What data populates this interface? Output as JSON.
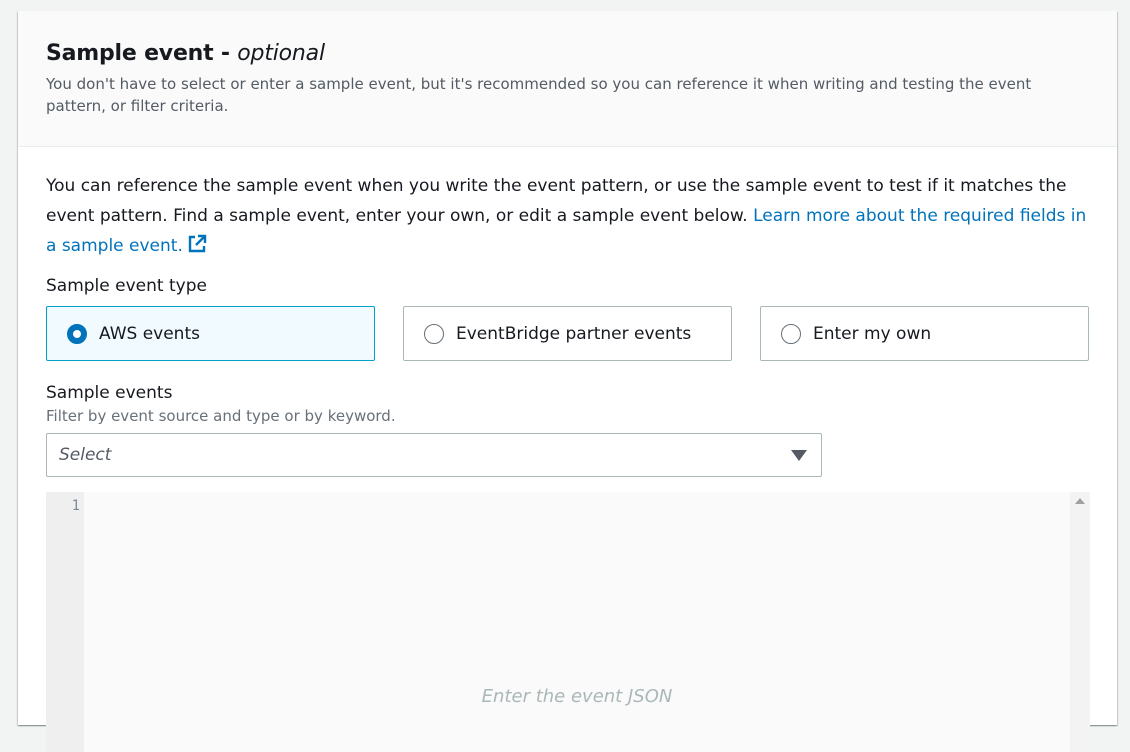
{
  "panel": {
    "title": "Sample event - ",
    "title_optional": "optional",
    "description": "You don't have to select or enter a sample event, but it's recommended so you can reference it when writing and testing the event pattern, or filter criteria."
  },
  "body": {
    "intro_text": "You can reference the sample event when you write the event pattern, or use the sample event to test if it matches the event pattern. Find a sample event, enter your own, or edit a sample event below. ",
    "learn_more_link": "Learn more about the required fields in a sample event.",
    "external_link_icon": "external-link-icon",
    "accent_color": "#0073bb"
  },
  "sample_event_type": {
    "label": "Sample event type",
    "options": [
      {
        "label": "AWS events",
        "selected": true
      },
      {
        "label": "EventBridge partner events",
        "selected": false
      },
      {
        "label": "Enter my own",
        "selected": false
      }
    ]
  },
  "sample_events": {
    "label": "Sample events",
    "hint": "Filter by event source and type or by keyword.",
    "select_placeholder": "Select"
  },
  "editor": {
    "line_number": "1",
    "placeholder": "Enter the event JSON"
  }
}
